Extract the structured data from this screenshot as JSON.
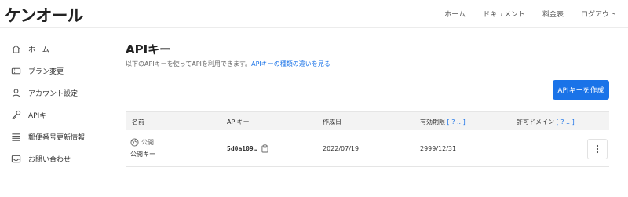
{
  "brand": {
    "logo_text": "ケンオール"
  },
  "topnav": {
    "items": [
      "ホーム",
      "ドキュメント",
      "料金表",
      "ログアウト"
    ]
  },
  "sidebar": {
    "items": [
      {
        "label": "ホーム",
        "icon": "home-icon"
      },
      {
        "label": "プラン変更",
        "icon": "ticket-icon"
      },
      {
        "label": "アカウント設定",
        "icon": "user-icon"
      },
      {
        "label": "APIキー",
        "icon": "key-icon"
      },
      {
        "label": "郵便番号更新情報",
        "icon": "list-icon"
      },
      {
        "label": "お問い合わせ",
        "icon": "mail-icon"
      }
    ]
  },
  "page": {
    "title": "APIキー",
    "subtitle": "以下のAPIキーを使ってAPIを利用できます。",
    "subtitle_link": "APIキーの種類の違いを見る",
    "create_button": "APIキーを作成"
  },
  "table": {
    "headers": {
      "name": "名前",
      "api_key": "APIキー",
      "created": "作成日",
      "expires": "有効期限",
      "expires_help": "[ ? ...]",
      "allowed_domains": "許可ドメイン",
      "allowed_domains_help": "[ ? ...]"
    },
    "rows": [
      {
        "badge": "公開",
        "name": "公開キー",
        "api_key": "5d0a109…",
        "created": "2022/07/19",
        "expires": "2999/12/31",
        "allowed_domains": ""
      }
    ]
  },
  "colors": {
    "accent": "#1a73e8",
    "header_bg": "#f3f3f3"
  }
}
